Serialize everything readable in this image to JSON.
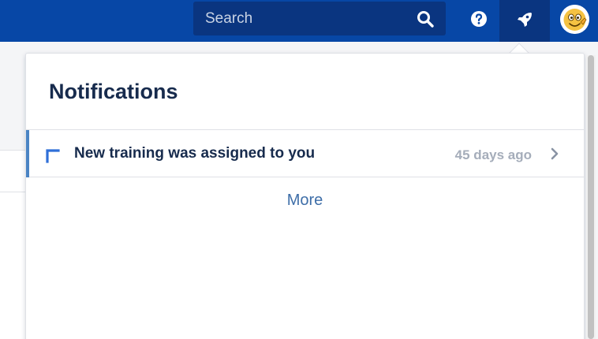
{
  "topbar": {
    "search_placeholder": "Search",
    "icons": {
      "search": "search-icon",
      "help": "help-icon",
      "notifications": "rocket-icon",
      "avatar": "user-avatar"
    },
    "colors": {
      "bar": "#0747a6",
      "active": "#0a3580"
    }
  },
  "notifications": {
    "title": "Notifications",
    "items": [
      {
        "text": "New training was assigned to you",
        "time": "45 days ago",
        "unread": true
      }
    ],
    "more_label": "More"
  }
}
